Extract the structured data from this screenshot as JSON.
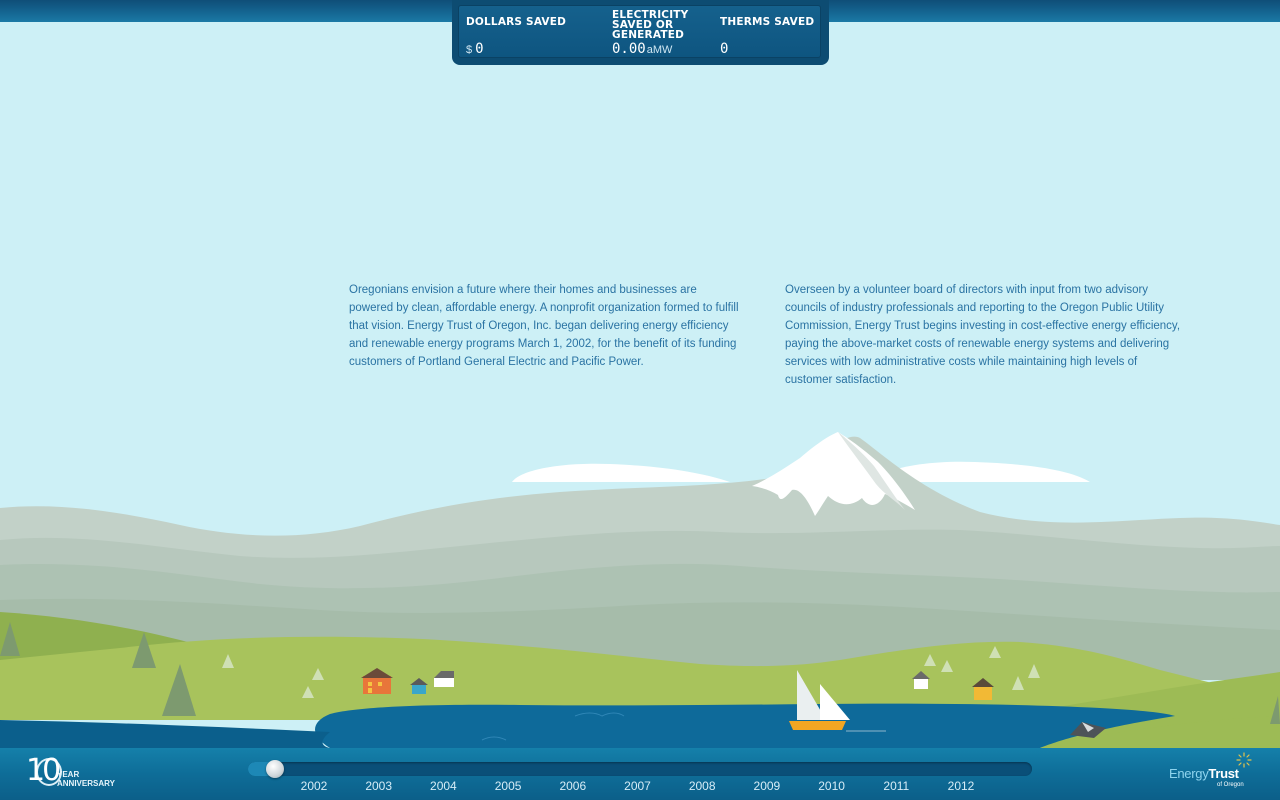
{
  "stats": [
    {
      "label": "DOLLARS SAVED",
      "prefix": "$",
      "value": "0",
      "unit": ""
    },
    {
      "label": "ELECTRICITY\nSAVED OR\nGENERATED",
      "prefix": "",
      "value": "0.00",
      "unit": "aMW"
    },
    {
      "label": "THERMS SAVED",
      "prefix": "",
      "value": "0",
      "unit": ""
    }
  ],
  "content": {
    "paragraph_left": "Oregonians envision a future where their homes and businesses are powered by clean, affordable energy. A nonprofit organization formed to fulfill that vision. Energy Trust of Oregon, Inc. began delivering energy efficiency and renewable energy programs March 1, 2002, for the benefit of its funding customers of Portland General Electric and Pacific Power.",
    "paragraph_right": "Overseen by a volunteer board of directors with input from two advisory councils of industry professionals and reporting to the Oregon Public Utility Commission, Energy Trust begins investing in cost-effective energy efficiency, paying the above-market costs of renewable energy systems and delivering services with low administrative costs while maintaining high levels of customer satisfaction."
  },
  "anniversary": {
    "number": "10",
    "text": "YEAR\nANNIVERSARY"
  },
  "timeline": {
    "years": [
      "2002",
      "2003",
      "2004",
      "2005",
      "2006",
      "2007",
      "2008",
      "2009",
      "2010",
      "2011",
      "2012"
    ],
    "progress": 0.02
  },
  "logo": {
    "part1": "Energy",
    "part2": "Trust",
    "sub": "of Oregon"
  },
  "colors": {
    "sky": "#cdf0f6",
    "bar": "#0e6d98",
    "text": "#2a73a3",
    "lake": "#0e6a9a",
    "hills": "#a9c55d"
  }
}
